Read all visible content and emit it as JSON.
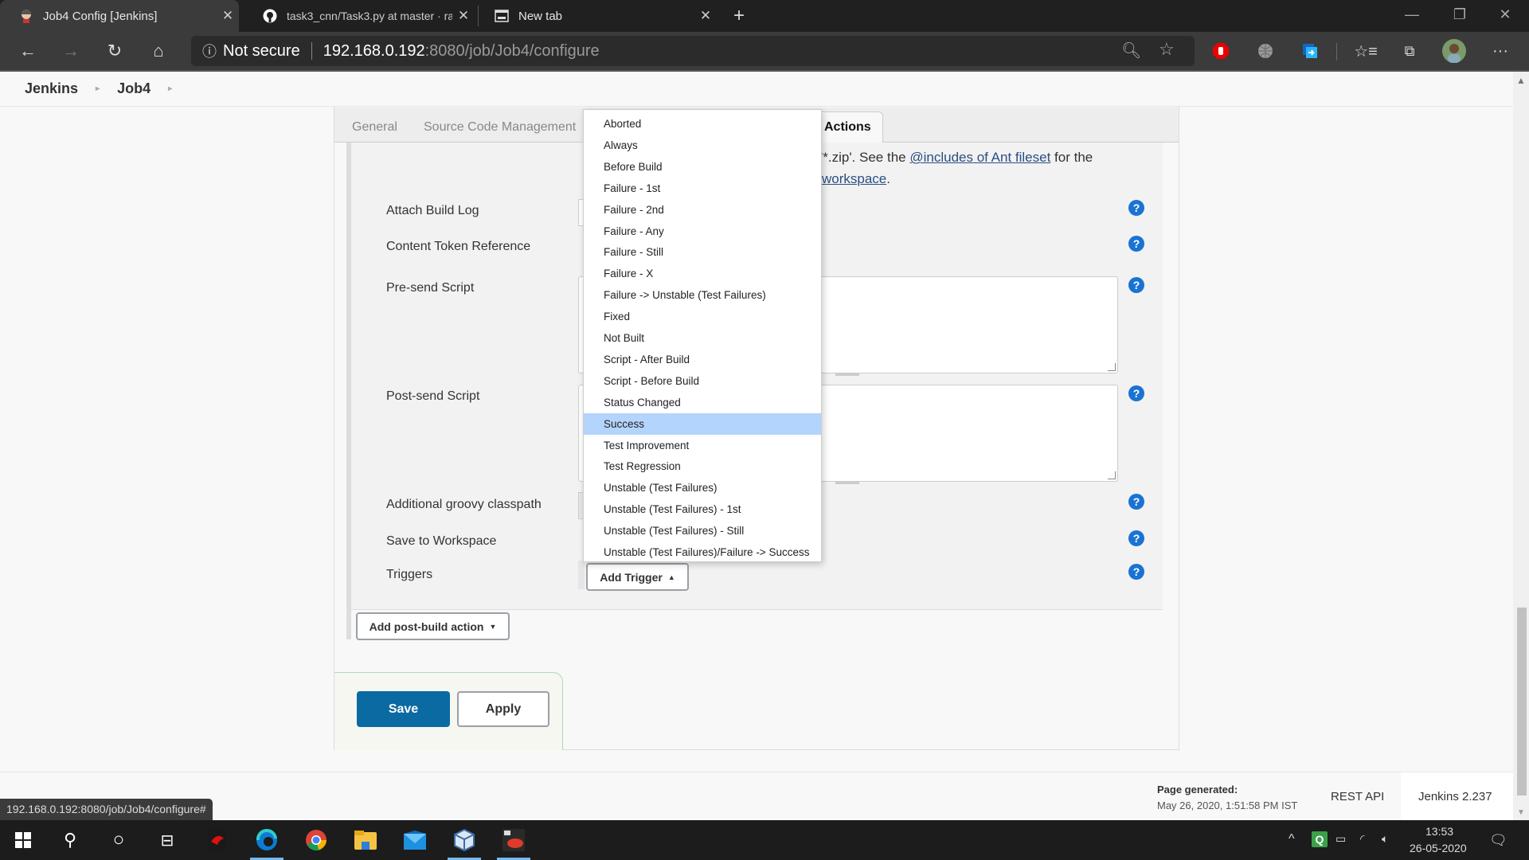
{
  "browser": {
    "tabs": [
      {
        "title": "Job4 Config [Jenkins]",
        "icon": "jenkins-icon",
        "active": true
      },
      {
        "title": "task3_cnn/Task3.py at master · ra",
        "icon": "github-icon",
        "active": false
      },
      {
        "title": "New tab",
        "icon": "new-tab-page-icon",
        "active": false
      }
    ],
    "address": {
      "security_label": "Not secure",
      "host": "192.168.0.192",
      "path": ":8080/job/Job4/configure"
    },
    "status_url": "192.168.0.192:8080/job/Job4/configure#"
  },
  "breadcrumb": [
    "Jenkins",
    "Job4"
  ],
  "config_tabs": [
    "General",
    "Source Code Management",
    "Actions"
  ],
  "active_tab": "Actions",
  "description": {
    "line1_prefix": "'*.zip'. See the ",
    "line1_link": "@includes of Ant fileset",
    "line1_suffix": " for the",
    "line2_link": "workspace",
    "line2_suffix": "."
  },
  "fields": [
    {
      "label": "Attach Build Log"
    },
    {
      "label": "Content Token Reference"
    },
    {
      "label": "Pre-send Script",
      "value": ""
    },
    {
      "label": "Post-send Script",
      "value": ""
    },
    {
      "label": "Additional groovy classpath"
    },
    {
      "label": "Save to Workspace"
    },
    {
      "label": "Triggers"
    }
  ],
  "help_label": "?",
  "trigger_menu": {
    "items": [
      "Aborted",
      "Always",
      "Before Build",
      "Failure - 1st",
      "Failure - 2nd",
      "Failure - Any",
      "Failure - Still",
      "Failure - X",
      "Failure -> Unstable (Test Failures)",
      "Fixed",
      "Not Built",
      "Script - After Build",
      "Script - Before Build",
      "Status Changed",
      "Success",
      "Test Improvement",
      "Test Regression",
      "Unstable (Test Failures)",
      "Unstable (Test Failures) - 1st",
      "Unstable (Test Failures) - Still",
      "Unstable (Test Failures)/Failure -> Success"
    ],
    "highlighted": "Success",
    "highlight_color": "#b3d4fc"
  },
  "buttons": {
    "add_trigger": "Add Trigger",
    "add_post_build": "Add post-build action",
    "save": "Save",
    "apply": "Apply"
  },
  "colors": {
    "save_button": "#0b6aa2",
    "help_icon": "#1a73d2",
    "link": "#2a4f82"
  },
  "footer": {
    "page_generated_label": "Page generated:",
    "page_generated_value": "May 26, 2020, 1:51:58 PM IST",
    "rest_api": "REST API",
    "version": "Jenkins 2.237"
  },
  "taskbar": {
    "time": "13:53",
    "date": "26-05-2020"
  }
}
